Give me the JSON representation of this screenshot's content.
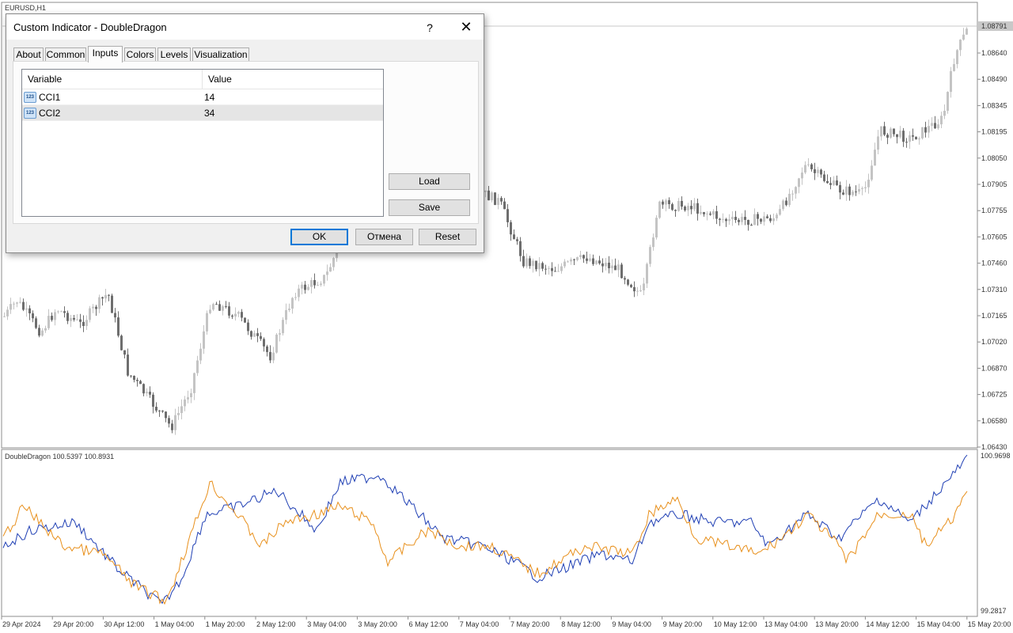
{
  "chart": {
    "symbol_label": "EURUSD,H1",
    "indicator_label": "DoubleDragon 100.5397 100.8931",
    "price_levels": [
      "1.08640",
      "1.08490",
      "1.08345",
      "1.08195",
      "1.08050",
      "1.07905",
      "1.07755",
      "1.07605",
      "1.07460",
      "1.07310",
      "1.07165",
      "1.07020",
      "1.06870",
      "1.06725",
      "1.06580",
      "1.06430"
    ],
    "current_price": "1.08791",
    "indicator_max": "100.9698",
    "indicator_min": "99.2817",
    "time_labels": [
      "29 Apr 2024",
      "29 Apr 20:00",
      "30 Apr 12:00",
      "1 May 04:00",
      "1 May 20:00",
      "2 May 12:00",
      "3 May 04:00",
      "3 May 20:00",
      "6 May 12:00",
      "7 May 04:00",
      "7 May 20:00",
      "8 May 12:00",
      "9 May 04:00",
      "9 May 20:00",
      "10 May 12:00",
      "13 May 04:00",
      "13 May 20:00",
      "14 May 12:00",
      "15 May 04:00",
      "15 May 20:00"
    ],
    "colors": {
      "candle_dark": "#6e6e6e",
      "candle_light": "#c4c4c4",
      "cci1_line": "#1f3fb4",
      "cci2_line": "#e8901c",
      "price_tag_bg": "#c8c8c8"
    }
  },
  "dialog": {
    "title": "Custom Indicator - DoubleDragon",
    "help_label": "?",
    "close_label": "✕",
    "tabs": [
      {
        "label": "About",
        "active": false
      },
      {
        "label": "Common",
        "active": false
      },
      {
        "label": "Inputs",
        "active": true
      },
      {
        "label": "Colors",
        "active": false
      },
      {
        "label": "Levels",
        "active": false
      },
      {
        "label": "Visualization",
        "active": false
      }
    ],
    "table": {
      "headers": [
        "Variable",
        "Value"
      ],
      "rows": [
        {
          "variable": "CCI1",
          "value": "14",
          "icon": "123-icon",
          "icon_text": "123",
          "selected": false
        },
        {
          "variable": "CCI2",
          "value": "34",
          "icon": "123-icon",
          "icon_text": "123",
          "selected": true
        }
      ]
    },
    "buttons": {
      "load": "Load",
      "save": "Save",
      "ok": "OK",
      "cancel": "Отмена",
      "reset": "Reset"
    }
  }
}
